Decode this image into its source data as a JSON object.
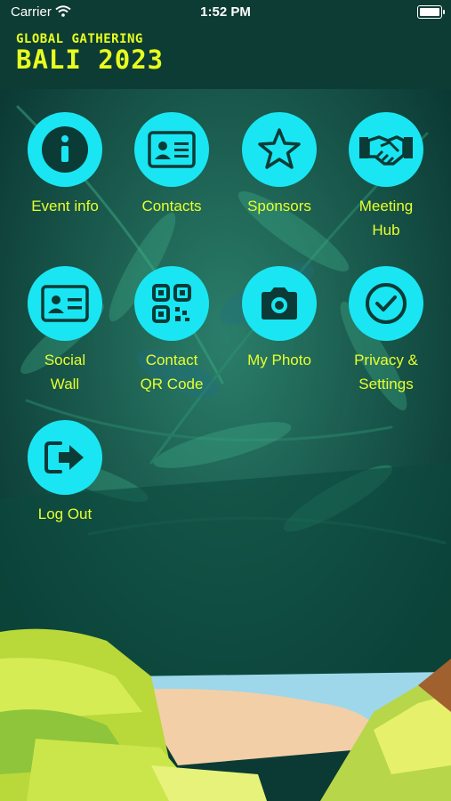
{
  "status_bar": {
    "carrier": "Carrier",
    "time": "1:52 PM"
  },
  "header": {
    "logo_line1": "GLOBAL GATHERING",
    "logo_line2": "BALI 2023"
  },
  "menu": [
    {
      "label": "Event info",
      "icon": "info-icon"
    },
    {
      "label": "Contacts",
      "icon": "id-card-icon"
    },
    {
      "label": "Sponsors",
      "icon": "star-icon"
    },
    {
      "label": "Meeting\nHub",
      "icon": "handshake-icon"
    },
    {
      "label": "Social\nWall",
      "icon": "profile-card-icon"
    },
    {
      "label": "Contact\nQR Code",
      "icon": "qr-code-icon"
    },
    {
      "label": "My Photo",
      "icon": "camera-icon"
    },
    {
      "label": "Privacy &\nSettings",
      "icon": "check-circle-icon"
    },
    {
      "label": "Log Out",
      "icon": "logout-icon"
    }
  ],
  "colors": {
    "accent": "#19e6f2",
    "label": "#e7ff2c",
    "header_bg": "#0d3c34",
    "icon_dark": "#0a3b37"
  }
}
